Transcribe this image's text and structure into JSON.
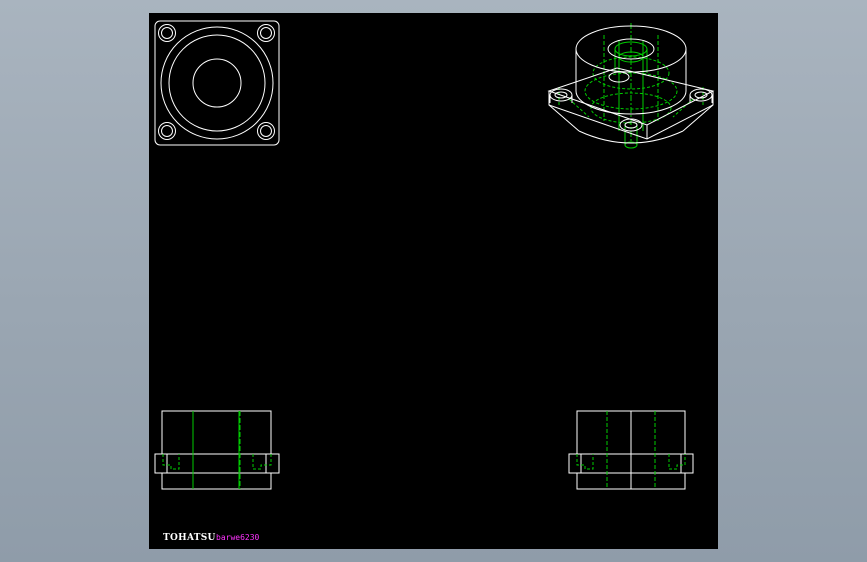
{
  "title_block": {
    "brand": "TOHATSU",
    "part_number": "barwe6230"
  },
  "views": [
    {
      "name": "top-view"
    },
    {
      "name": "isometric-view"
    },
    {
      "name": "front-view-left"
    },
    {
      "name": "front-view-right"
    }
  ],
  "colors": {
    "background": "#000000",
    "outline": "#ffffff",
    "hidden": "#00cc00",
    "text_accent": "#ff33ff",
    "frame": "#9ba7b3"
  }
}
